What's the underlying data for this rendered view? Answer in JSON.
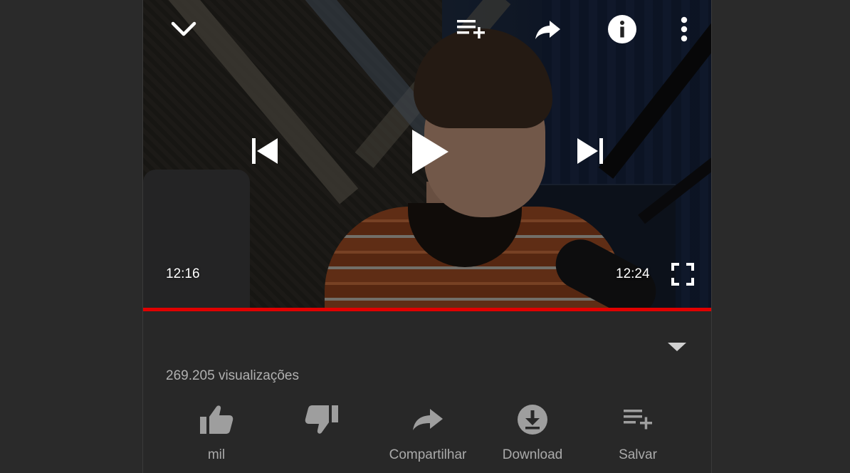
{
  "player": {
    "current_time": "12:16",
    "total_time": "12:24",
    "progress": 1.0,
    "progress_color": "#e00000"
  },
  "top_bar": {
    "icons": [
      "chevron-down-icon",
      "add-to-queue-icon",
      "share-icon",
      "info-icon",
      "more-vert-icon"
    ]
  },
  "center_controls": {
    "icons": [
      "skip-previous-icon",
      "play-icon",
      "skip-next-icon"
    ]
  },
  "video": {
    "views": "269.205 visualizações"
  },
  "actions": [
    {
      "icon": "thumbs-up-icon",
      "label": "mil"
    },
    {
      "icon": "thumbs-down-icon",
      "label": ""
    },
    {
      "icon": "share-icon",
      "label": "Compartilhar"
    },
    {
      "icon": "download-icon",
      "label": "Download"
    },
    {
      "icon": "playlist-add-icon",
      "label": "Salvar"
    }
  ],
  "colors": {
    "background": "#282828",
    "icon_gray": "#9e9e9e",
    "text_gray": "#aaaaaa",
    "overlay_white": "#ffffff"
  }
}
